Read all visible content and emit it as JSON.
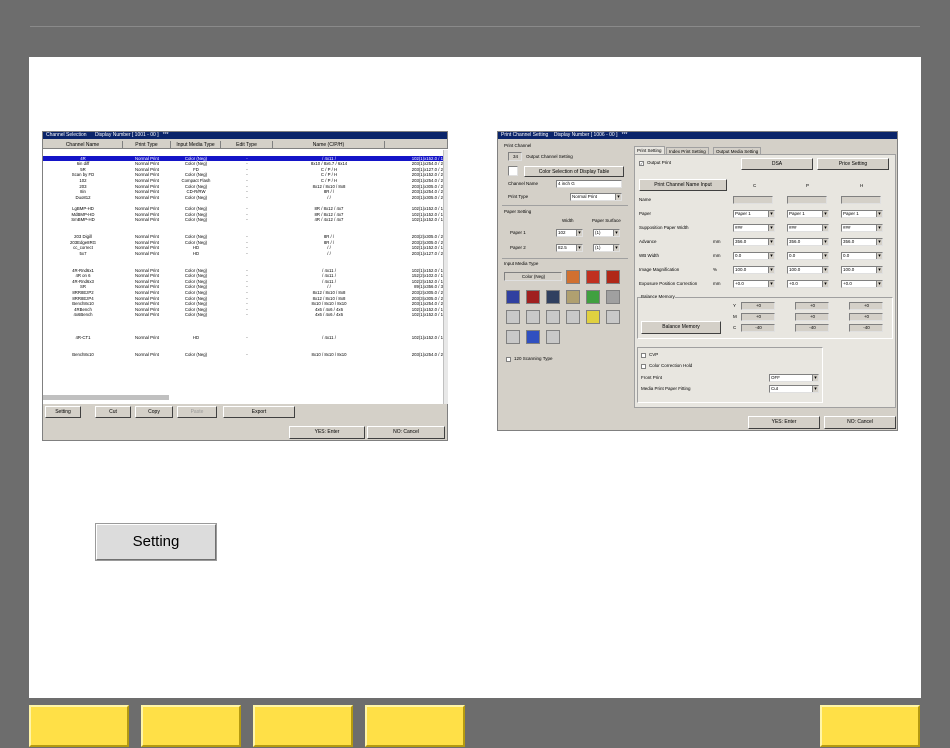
{
  "left_window": {
    "title": "Channel Selection",
    "display_number": "Display Number [ 1001 - 00 ]",
    "stars": "***",
    "columns": [
      "Channel Name",
      "Print Type",
      "Input Media Type",
      "Edit Type",
      "Name (C/P/H)"
    ],
    "rows": [
      {
        "name": "",
        "ptype": "",
        "media": "",
        "edit": "",
        "cph": "",
        "size": ""
      },
      {
        "name": "4R",
        "ptype": "Normal Print",
        "media": "Color (Neg)",
        "edit": "-",
        "cph": "/ 4x11 /",
        "size": "102(1)x152.0 / 1",
        "selected": true
      },
      {
        "name": "6in diff",
        "ptype": "Normal Print",
        "media": "Color (Neg)",
        "edit": "-",
        "cph": "8x10 / 8x6.7 / 6x14",
        "size": "203(1)x254.0 / 2"
      },
      {
        "name": "5R",
        "ptype": "Normal Print",
        "media": "FD",
        "edit": "-",
        "cph": "C / P / H",
        "size": "203(1)x127.0 / 2"
      },
      {
        "name": "Scan by FD",
        "ptype": "Normal Print",
        "media": "Color (Neg)",
        "edit": "-",
        "cph": "C / P / H",
        "size": "203(1)x152.0 / 2"
      },
      {
        "name": "102",
        "ptype": "Normal Print",
        "media": "Compact Flash",
        "edit": "-",
        "cph": "C / P / H",
        "size": "203(1)x254.0 / 2"
      },
      {
        "name": "203",
        "ptype": "Normal Print",
        "media": "Color (Neg)",
        "edit": "-",
        "cph": "8x12 / 8x10 / 8x8",
        "size": "203(1)x305.0 / 2"
      },
      {
        "name": "8in",
        "ptype": "Normal Print",
        "media": "CD-R/RW",
        "edit": "-",
        "cph": "8R / /",
        "size": "203(1)x254.0 / 2"
      },
      {
        "name": "Duo812",
        "ptype": "Normal Print",
        "media": "Color (Neg)",
        "edit": "-",
        "cph": "/ /",
        "size": "203(1)x305.0 / 2"
      },
      {
        "name": "",
        "ptype": "",
        "media": "",
        "edit": "",
        "cph": "",
        "size": ""
      },
      {
        "name": "LgBMP-HD",
        "ptype": "Normal Print",
        "media": "Color (Neg)",
        "edit": "-",
        "cph": "8R / 8x12 / 4x7",
        "size": "102(1)x152.0 / 1"
      },
      {
        "name": "MdBMP-HD",
        "ptype": "Normal Print",
        "media": "Color (Neg)",
        "edit": "-",
        "cph": "8R / 8x12 / 4x7",
        "size": "102(1)x152.0 / 1"
      },
      {
        "name": "SmBMP-HD",
        "ptype": "Normal Print",
        "media": "Color (Neg)",
        "edit": "-",
        "cph": "4R / 4x12 / 4x7",
        "size": "102(1)x152.0 / 1"
      },
      {
        "name": "",
        "ptype": "",
        "media": "",
        "edit": "",
        "cph": "",
        "size": ""
      },
      {
        "name": "",
        "ptype": "",
        "media": "",
        "edit": "",
        "cph": "",
        "size": ""
      },
      {
        "name": "203 Digill",
        "ptype": "Normal Print",
        "media": "Color (Neg)",
        "edit": "-",
        "cph": "8R / /",
        "size": "203(2)x305.0 / 2"
      },
      {
        "name": "203Edge8RG",
        "ptype": "Normal Print",
        "media": "Color (Neg)",
        "edit": "-",
        "cph": "8R / /",
        "size": "203(2)x305.0 / 2"
      },
      {
        "name": "cc_correct",
        "ptype": "Normal Print",
        "media": "HD",
        "edit": "-",
        "cph": "/ /",
        "size": "102(1)x152.0 / 1"
      },
      {
        "name": "5x7",
        "ptype": "Normal Print",
        "media": "HD",
        "edit": "-",
        "cph": "/ /",
        "size": "203(1)x127.0 / 2"
      },
      {
        "name": "",
        "ptype": "",
        "media": "",
        "edit": "",
        "cph": "",
        "size": ""
      },
      {
        "name": "",
        "ptype": "",
        "media": "",
        "edit": "",
        "cph": "",
        "size": ""
      },
      {
        "name": "4R-Rnd6x1",
        "ptype": "Normal Print",
        "media": "Color (Neg)",
        "edit": "-",
        "cph": "/ 4x11 /",
        "size": "102(1)x152.0 / 1"
      },
      {
        "name": "4R on 6",
        "ptype": "Normal Print",
        "media": "Color (Neg)",
        "edit": "-",
        "cph": "/ 4x11 /",
        "size": "152(2)x102.0 / 1"
      },
      {
        "name": "4R-Rnd6x3",
        "ptype": "Normal Print",
        "media": "Color (Neg)",
        "edit": "-",
        "cph": "/ 4x11 /",
        "size": "102(2)x152.0 / 1"
      },
      {
        "name": "SR",
        "ptype": "Normal Print",
        "media": "Color (Neg)",
        "edit": "-",
        "cph": "/ /",
        "size": "89(1)x356.0 / 3"
      },
      {
        "name": "8RR8EzP2",
        "ptype": "Normal Print",
        "media": "Color (Neg)",
        "edit": "-",
        "cph": "8x12 / 8x10 / 8x8",
        "size": "203(2)x305.0 / 2"
      },
      {
        "name": "8RR8EzP4",
        "ptype": "Normal Print",
        "media": "Color (Neg)",
        "edit": "-",
        "cph": "8x12 / 8x10 / 8x8",
        "size": "203(3)x305.0 / 2"
      },
      {
        "name": "Bench8x10",
        "ptype": "Normal Print",
        "media": "Color (Neg)",
        "edit": "-",
        "cph": "8x10 / 8x10 / 8x10",
        "size": "203(1)x254.0 / 2"
      },
      {
        "name": "4RBench",
        "ptype": "Normal Print",
        "media": "Color (Neg)",
        "edit": "-",
        "cph": "4x6 / 4x6 / 4x6",
        "size": "102(1)x152.0 / 1"
      },
      {
        "name": "4x6Bench",
        "ptype": "Normal Print",
        "media": "Color (Neg)",
        "edit": "-",
        "cph": "4x6 / 4x6 / 4x6",
        "size": "102(1)x152.0 / 1"
      },
      {
        "name": "",
        "ptype": "",
        "media": "",
        "edit": "",
        "cph": "",
        "size": ""
      },
      {
        "name": "",
        "ptype": "",
        "media": "",
        "edit": "",
        "cph": "",
        "size": ""
      },
      {
        "name": "",
        "ptype": "",
        "media": "",
        "edit": "",
        "cph": "",
        "size": ""
      },
      {
        "name": "4R-CT1",
        "ptype": "Normal Print",
        "media": "HD",
        "edit": "-",
        "cph": "/ 4x11 /",
        "size": "102(1)x152.0 / 1"
      },
      {
        "name": "",
        "ptype": "",
        "media": "",
        "edit": "",
        "cph": "",
        "size": ""
      },
      {
        "name": "",
        "ptype": "",
        "media": "",
        "edit": "",
        "cph": "",
        "size": ""
      },
      {
        "name": "Bench8x10",
        "ptype": "Normal Print",
        "media": "Color (Neg)",
        "edit": "-",
        "cph": "8x10 / 8x10 / 8x10",
        "size": "203(1)x254.0 / 2"
      }
    ],
    "buttons": {
      "setting": "Setting",
      "cut": "Cut",
      "copy": "Copy",
      "paste": "Paste",
      "export": "Export",
      "yes": "YES: Enter",
      "no": "NO: Cancel"
    }
  },
  "right_window": {
    "title": "Print Channel Setting",
    "display_number": "Display Number [ 1006 - 00 ]",
    "stars": "***",
    "print_channel_label": "Print Channel",
    "channel_number": "34",
    "output_channel_setting": "Output Channel Setting",
    "color_selection": "Color Selection of Display Table",
    "channel_name_label": "Channel Name",
    "channel_name_value": "4 inch G",
    "print_type_label": "Print Type",
    "print_type_value": "Normal Print",
    "paper_setting_label": "Paper Setting",
    "width_label": "Width",
    "paper_surface_label": "Paper Surface",
    "paper1_label": "Paper 1",
    "paper1_width": "102",
    "paper1_surface": "(1)",
    "paper2_label": "Paper 2",
    "paper2_width": "82.5",
    "paper2_surface": "(1)",
    "input_media_label": "Input Media Type",
    "input_media_value": "Color (Neg)",
    "scanning_type": "120 Scanning Type",
    "tabs": [
      "Print Setting",
      "Index Print Setting",
      "Output Media Setting"
    ],
    "output_print": "Output Print",
    "dsa_button": "DSA",
    "price_setting_button": "Price Setting",
    "print_channel_name_input": "Print Channel Name Input",
    "col_c": "C",
    "col_p": "P",
    "col_h": "H",
    "name_label": "Name",
    "params": [
      {
        "label": "Paper",
        "unit": "",
        "c": "Paper 1",
        "p": "Paper 1",
        "h": "Paper 1"
      },
      {
        "label": "Supposition Paper Width",
        "unit": "",
        "c": "###",
        "p": "###",
        "h": "###"
      },
      {
        "label": "Advance",
        "unit": "mm",
        "c": "356.0",
        "p": "356.0",
        "h": "356.0"
      },
      {
        "label": "WB Width",
        "unit": "mm",
        "c": "0.0",
        "p": "0.0",
        "h": "0.0"
      },
      {
        "label": "Image Magnification",
        "unit": "%",
        "c": "100.0",
        "p": "100.0",
        "h": "100.0"
      },
      {
        "label": "Exposure Position Correction",
        "unit": "mm",
        "c": "+0.0",
        "p": "+0.0",
        "h": "+0.0"
      }
    ],
    "balance_memory_label": "Balance Memory",
    "balance_memory_button": "Balance Memory",
    "balance_rows": [
      {
        "label": "Y",
        "c": "+0",
        "p": "+0",
        "h": "+0"
      },
      {
        "label": "M",
        "c": "+0",
        "p": "+0",
        "h": "+0"
      },
      {
        "label": "C",
        "c": "-40",
        "p": "-40",
        "h": "-40"
      }
    ],
    "cvp": "CVP",
    "color_correction_hold": "Color Correction Hold",
    "front_print_label": "Front Print",
    "front_print_value": "OFF",
    "media_print_paper_fitting_label": "Media Print Paper Fitting",
    "media_print_paper_fitting_value": "Cut",
    "yes": "YES: Enter",
    "no": "NO: Cancel"
  },
  "setting_button_label": "Setting",
  "colors": {
    "accent_yellow": "#ffe047",
    "selection": "#1414c8",
    "titlebar": "#0a246a"
  }
}
